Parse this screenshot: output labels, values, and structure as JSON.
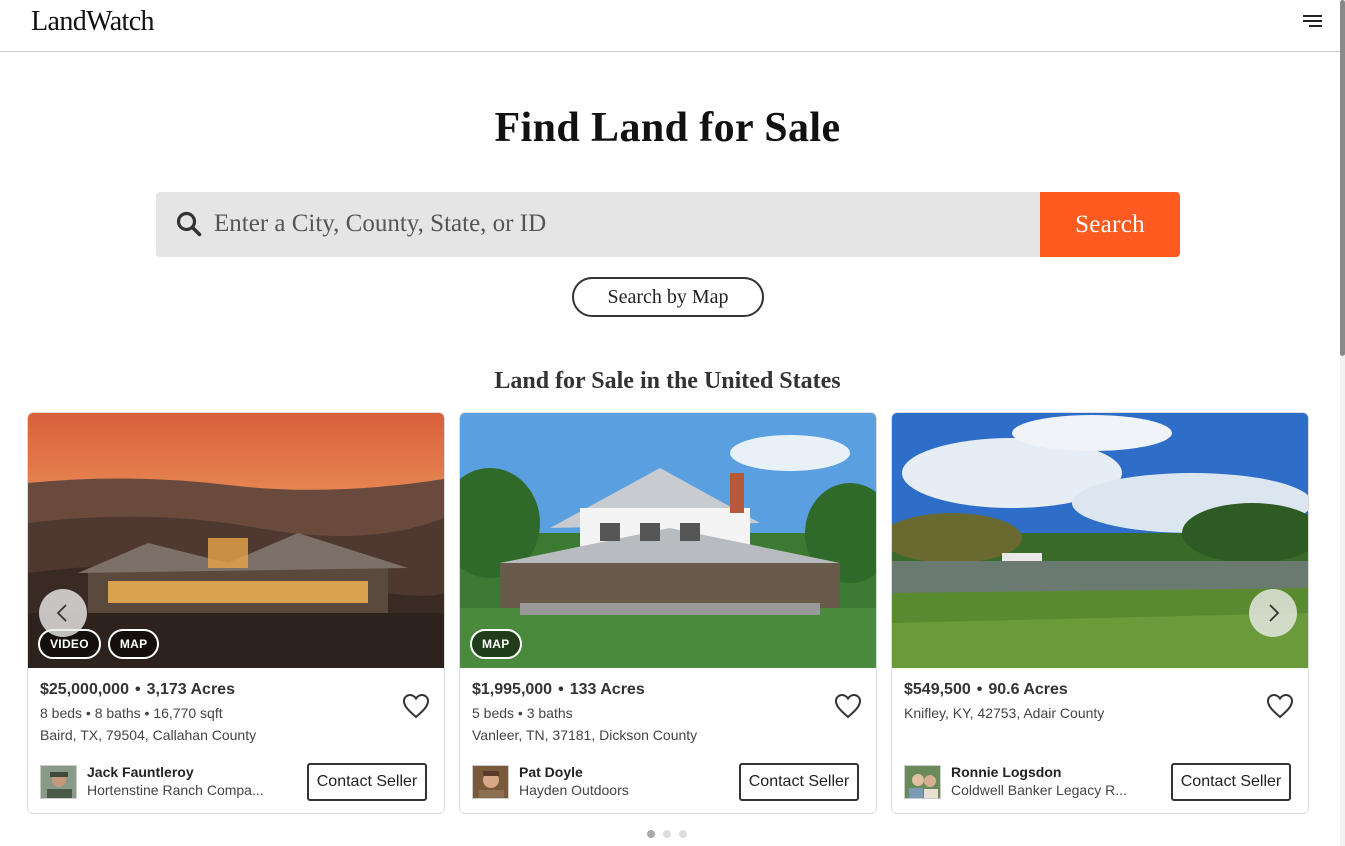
{
  "header": {
    "logo": "LandWatch",
    "menu_icon": "hamburger-menu-icon"
  },
  "hero": {
    "title": "Find Land for Sale",
    "search_placeholder": "Enter a City, County, State, or ID",
    "search_button": "Search",
    "map_button": "Search by Map"
  },
  "section": {
    "title": "Land for Sale in the United States"
  },
  "listings": [
    {
      "price": "$25,000,000",
      "acres": "3,173 Acres",
      "details": "8 beds • 8 baths • 16,770 sqft",
      "location": "Baird, TX, 79504, Callahan County",
      "badges": [
        "VIDEO",
        "MAP"
      ],
      "agent_name": "Jack Fauntleroy",
      "agent_company": "Hortenstine Ranch Compa...",
      "contact_label": "Contact Seller"
    },
    {
      "price": "$1,995,000",
      "acres": "133 Acres",
      "details": "5 beds • 3 baths",
      "location": "Vanleer, TN, 37181, Dickson County",
      "badges": [
        "MAP"
      ],
      "agent_name": "Pat Doyle",
      "agent_company": "Hayden Outdoors",
      "contact_label": "Contact Seller"
    },
    {
      "price": "$549,500",
      "acres": "90.6 Acres",
      "details": "",
      "location": "Knifley, KY, 42753, Adair County",
      "badges": [],
      "agent_name": "Ronnie Logsdon",
      "agent_company": "Coldwell Banker Legacy R...",
      "contact_label": "Contact Seller"
    }
  ],
  "carousel": {
    "pages": 3,
    "active_page": 1
  },
  "colors": {
    "accent": "#ff5a1f",
    "search_bg": "#e5e5e5",
    "text": "#222222"
  }
}
